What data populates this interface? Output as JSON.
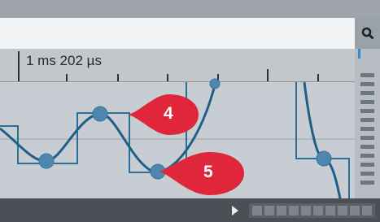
{
  "ruler": {
    "time_label": "1 ms 202 µs"
  },
  "markers": [
    {
      "label": "4",
      "color": "#e0263b"
    },
    {
      "label": "5",
      "color": "#e0263b"
    }
  ],
  "colors": {
    "wave_line": "#1f5f87",
    "sample_step": "#2d6e97",
    "sample_point": "#4f86ae",
    "background": "#c7cdd2"
  },
  "icons": {
    "search": "search-icon",
    "play": "play-icon"
  }
}
